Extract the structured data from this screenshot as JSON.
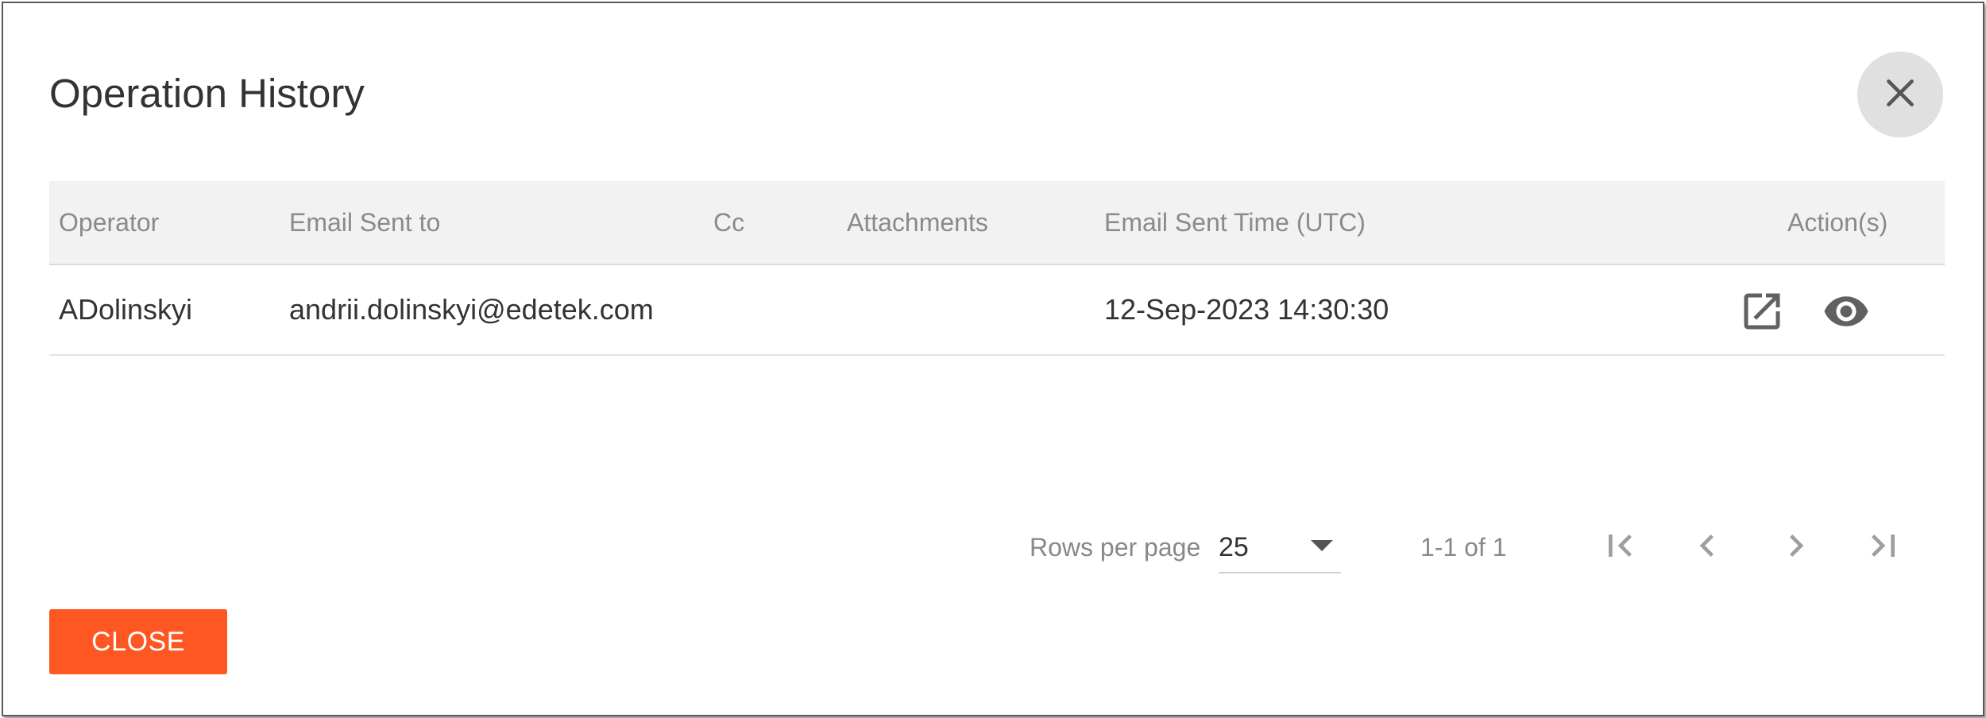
{
  "dialog": {
    "title": "Operation History",
    "close_button_label": "CLOSE"
  },
  "table": {
    "columns": [
      "Operator",
      "Email Sent to",
      "Cc",
      "Attachments",
      "Email Sent Time (UTC)",
      "Action(s)"
    ],
    "rows": [
      {
        "operator": "ADolinskyi",
        "email_sent_to": "andrii.dolinskyi@edetek.com",
        "cc": "",
        "attachments": "",
        "email_sent_time": "12-Sep-2023 14:30:30",
        "actions": [
          "open-in-new-icon",
          "eye-icon"
        ]
      }
    ]
  },
  "pagination": {
    "rows_per_page_label": "Rows per page",
    "rows_per_page_value": "25",
    "range_label": "1-1 of 1"
  },
  "colors": {
    "accent": "#ff5722",
    "header_bg": "#f2f2f2",
    "close_circle_bg": "#e0e0e0"
  }
}
